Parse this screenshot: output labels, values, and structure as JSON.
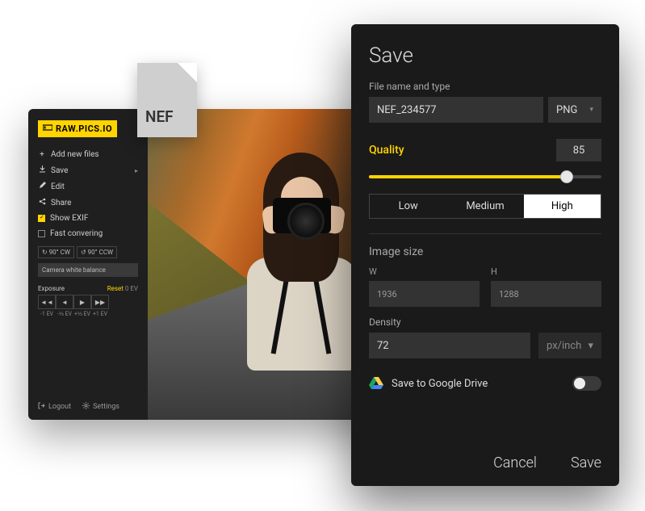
{
  "logo": "RAW.PICS.IO",
  "file_badge": "NEF",
  "sidebar": {
    "add_new_files": "Add new files",
    "save": "Save",
    "edit": "Edit",
    "share": "Share",
    "show_exif": "Show EXIF",
    "fast_converting": "Fast convering",
    "rotate_cw": "90° CW",
    "rotate_ccw": "90° CCW",
    "white_balance": "Camera white balance",
    "exposure_label": "Exposure",
    "reset_label": "Reset",
    "reset_value": "0 EV",
    "ev_btns": [
      "◄◄",
      "◄",
      "▶",
      "▶▶"
    ],
    "ev_labels": [
      "-1 EV",
      "-⅓ EV",
      "+⅓ EV",
      "+1 EV"
    ],
    "logout": "Logout",
    "settings": "Settings"
  },
  "save_panel": {
    "title": "Save",
    "filename_label": "File name and type",
    "filename": "NEF_234577",
    "filetype": "PNG",
    "quality_label": "Quality",
    "quality_value": "85",
    "quality_percent": 85,
    "presets": {
      "low": "Low",
      "medium": "Medium",
      "high": "High"
    },
    "image_size_label": "Image size",
    "w_label": "W",
    "h_label": "H",
    "width": "1936",
    "height": "1288",
    "density_label": "Density",
    "density": "72",
    "density_unit": "px/inch",
    "google_drive": "Save to Google Drive",
    "google_drive_on": false,
    "cancel": "Cancel",
    "save": "Save"
  }
}
